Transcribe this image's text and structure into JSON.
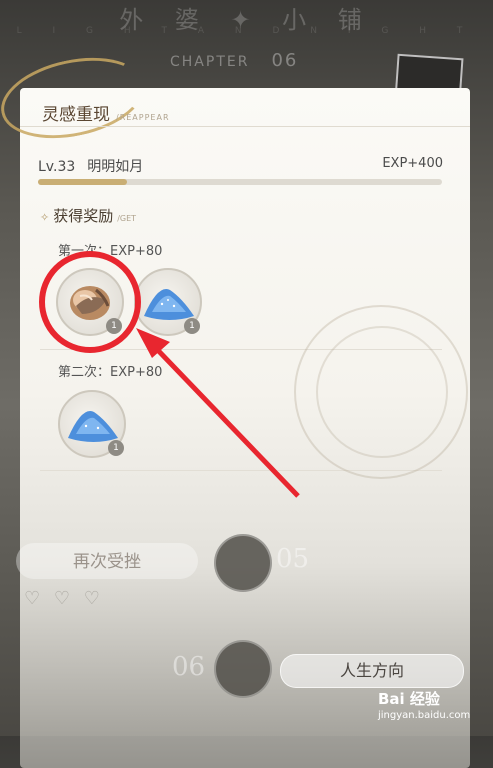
{
  "background": {
    "title": "外 婆 ✦ 小 铺",
    "subtitle": "L I G H T A N D N I G H T",
    "chapter_label": "CHAPTER",
    "chapter_number": "06"
  },
  "panel": {
    "title": "灵感重现",
    "title_en": "/REAPPEAR",
    "level": "Lv.33",
    "name": "明明如月",
    "exp": "EXP+400",
    "progress": 0.22,
    "rewards": {
      "title": "获得奖励",
      "title_en": "/GET",
      "first_label": "第一次：EXP+80",
      "first_items": [
        {
          "icon": "conch-shell-icon",
          "qty": "1"
        },
        {
          "icon": "blue-sand-icon",
          "qty": "1"
        }
      ],
      "second_label": "第二次：EXP+80",
      "second_items": [
        {
          "icon": "blue-sand-icon",
          "qty": "1"
        }
      ]
    }
  },
  "bottom": {
    "again_button": "再次受挫",
    "hearts": "♡ ♡ ♡",
    "node_05": "05",
    "node_06": "06",
    "life_button": "人生方向"
  },
  "watermark": {
    "brand": "Bai 经验",
    "url": "jingyan.baidu.com"
  },
  "colors": {
    "highlight_red": "#e8262f",
    "accent_gold": "#c9ae74"
  }
}
